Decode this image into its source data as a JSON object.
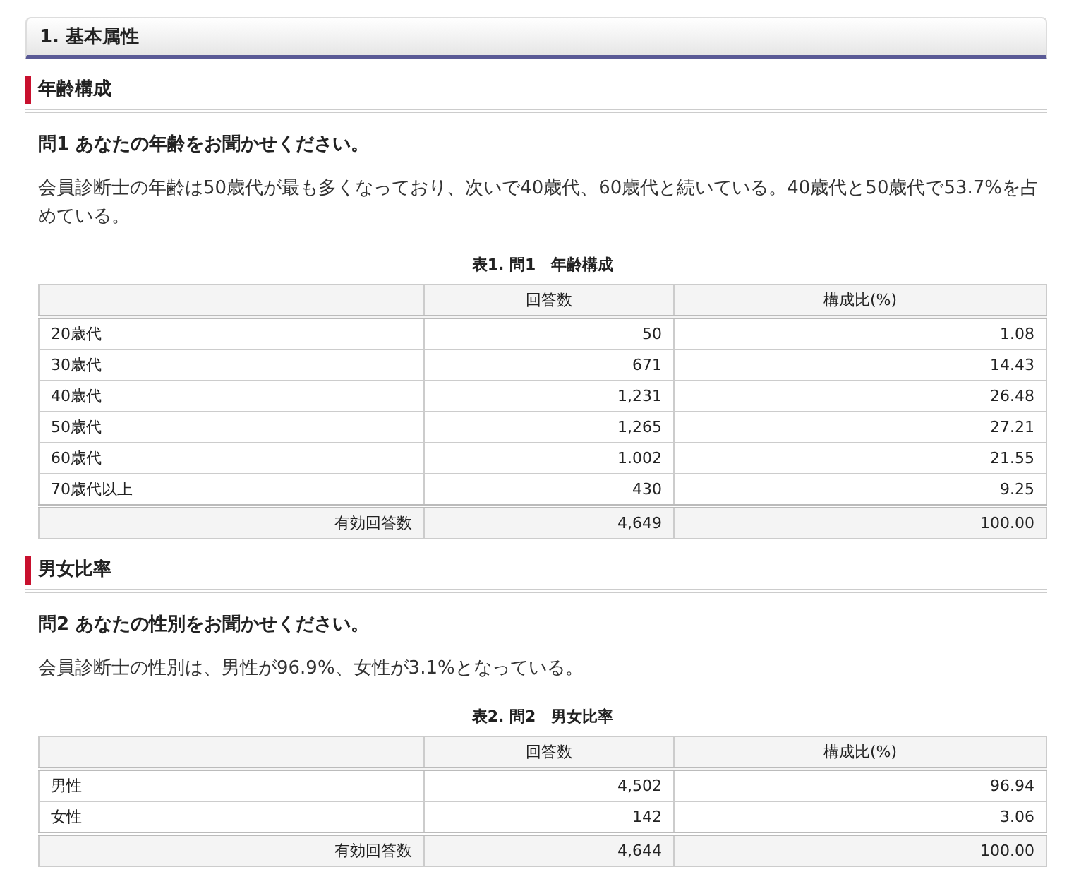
{
  "section": {
    "title": "1. 基本属性"
  },
  "subsections": [
    {
      "heading": "年齢構成",
      "question": "問1 あなたの年齢をお聞かせください。",
      "summary": "会員診断士の年齢は50歳代が最も多くなっており、次いで40歳代、60歳代と続いている。40歳代と50歳代で53.7%を占めている。",
      "table": {
        "caption": "表1. 問1　年齢構成",
        "columns": [
          "回答数",
          "構成比(%)"
        ],
        "rows": [
          {
            "label": "20歳代",
            "count": "50",
            "ratio": "1.08"
          },
          {
            "label": "30歳代",
            "count": "671",
            "ratio": "14.43"
          },
          {
            "label": "40歳代",
            "count": "1,231",
            "ratio": "26.48"
          },
          {
            "label": "50歳代",
            "count": "1,265",
            "ratio": "27.21"
          },
          {
            "label": "60歳代",
            "count": "1.002",
            "ratio": "21.55"
          },
          {
            "label": "70歳代以上",
            "count": "430",
            "ratio": "9.25"
          }
        ],
        "total": {
          "label": "有効回答数",
          "count": "4,649",
          "ratio": "100.00"
        }
      }
    },
    {
      "heading": "男女比率",
      "question": "問2 あなたの性別をお聞かせください。",
      "summary": "会員診断士の性別は、男性が96.9%、女性が3.1%となっている。",
      "table": {
        "caption": "表2. 問2　男女比率",
        "columns": [
          "回答数",
          "構成比(%)"
        ],
        "rows": [
          {
            "label": "男性",
            "count": "4,502",
            "ratio": "96.94"
          },
          {
            "label": "女性",
            "count": "142",
            "ratio": "3.06"
          }
        ],
        "total": {
          "label": "有効回答数",
          "count": "4,644",
          "ratio": "100.00"
        }
      }
    }
  ]
}
